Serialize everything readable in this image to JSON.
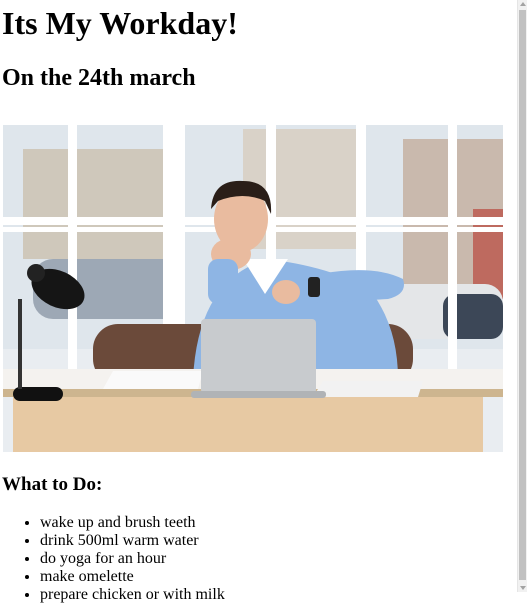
{
  "page": {
    "title": "Its My Workday!",
    "subtitle": "On the 24th march",
    "section_heading": "What to Do:",
    "todo_items": [
      "wake up and brush teeth",
      "drink 500ml warm water",
      "do yoga for an hour",
      "make omelette",
      "prepare chicken or with milk"
    ]
  }
}
